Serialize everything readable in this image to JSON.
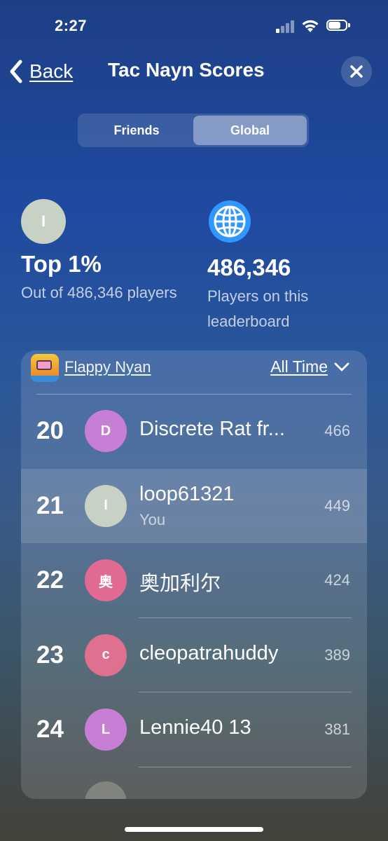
{
  "status_bar": {
    "time": "2:27"
  },
  "nav": {
    "back_label": "Back",
    "title": "Tac Nayn Scores"
  },
  "segments": [
    {
      "label": "Friends",
      "active": false
    },
    {
      "label": "Global",
      "active": true
    }
  ],
  "stats": {
    "rank": {
      "avatar_initial": "I",
      "value": "Top 1%",
      "subtitle": "Out of 486,346 players"
    },
    "players": {
      "value": "486,346",
      "subtitle": "Players on this leaderboard"
    }
  },
  "leaderboard": {
    "game_name": "Flappy Nyan",
    "period": "All Time",
    "rows": [
      {
        "rank": "20",
        "initial": "D",
        "name": "Discrete Rat fr...",
        "sub": "",
        "score": "466",
        "avatar_color": "#c77fd6"
      },
      {
        "rank": "21",
        "initial": "I",
        "name": "loop61321",
        "sub": "You",
        "score": "449",
        "avatar_color": "#c7d1c4"
      },
      {
        "rank": "22",
        "initial": "奥",
        "name": "奥加利尔",
        "sub": "",
        "score": "424",
        "avatar_color": "#e06a92"
      },
      {
        "rank": "23",
        "initial": "c",
        "name": "cleopatrahuddy",
        "sub": "",
        "score": "389",
        "avatar_color": "#e0708f"
      },
      {
        "rank": "24",
        "initial": "L",
        "name": "Lennie40 13",
        "sub": "",
        "score": "381",
        "avatar_color": "#c77fd6"
      }
    ]
  },
  "colors": {
    "accent_globe": "#2f97ff",
    "highlight_row": "rgba(255,255,255,0.13)"
  },
  "icons": {
    "back": "chevron-left-icon",
    "close": "close-icon",
    "globe": "globe-icon",
    "dropdown": "chevron-down-icon"
  }
}
